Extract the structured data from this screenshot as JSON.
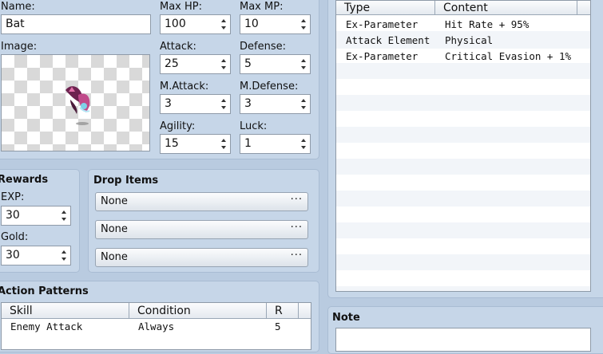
{
  "general": {
    "name_label": "Name:",
    "name_value": "Bat",
    "image_label": "Image:",
    "max_hp_label": "Max HP:",
    "max_hp": "100",
    "max_mp_label": "Max MP:",
    "max_mp": "10",
    "attack_label": "Attack:",
    "attack": "25",
    "defense_label": "Defense:",
    "defense": "5",
    "mattack_label": "M.Attack:",
    "mattack": "3",
    "mdefense_label": "M.Defense:",
    "mdefense": "3",
    "agility_label": "Agility:",
    "agility": "15",
    "luck_label": "Luck:",
    "luck": "1"
  },
  "rewards": {
    "title": "Rewards",
    "exp_label": "EXP:",
    "exp": "30",
    "gold_label": "Gold:",
    "gold": "30"
  },
  "drop_items": {
    "title": "Drop Items",
    "items": [
      "None",
      "None",
      "None"
    ],
    "dots": "···"
  },
  "action_patterns": {
    "title": "Action Patterns",
    "columns": [
      "Skill",
      "Condition",
      "R"
    ],
    "rows": [
      {
        "skill": "Enemy Attack",
        "condition": "Always",
        "rating": "5"
      }
    ]
  },
  "traits": {
    "columns": [
      "Type",
      "Content"
    ],
    "rows": [
      {
        "type": "Ex-Parameter",
        "content": "Hit Rate + 95%"
      },
      {
        "type": "Attack Element",
        "content": "Physical"
      },
      {
        "type": "Ex-Parameter",
        "content": "Critical Evasion + 1%"
      }
    ]
  },
  "note": {
    "title": "Note"
  },
  "colors": {
    "background": "#b9cbe0",
    "panel": "#c6d6e8"
  }
}
